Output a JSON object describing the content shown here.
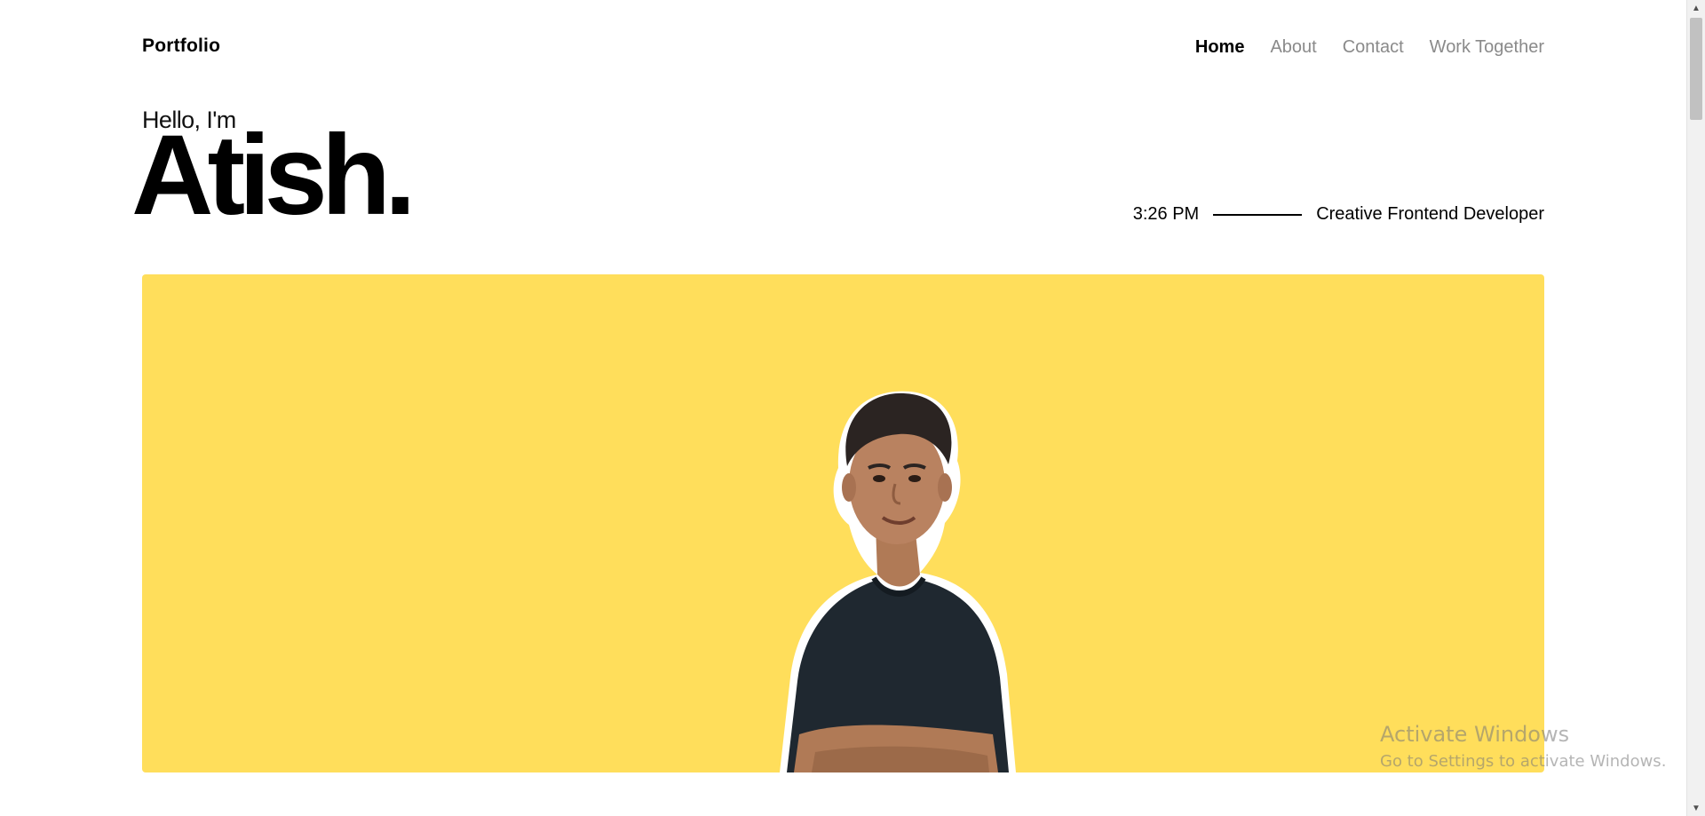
{
  "header": {
    "brand": "Portfolio",
    "nav": [
      {
        "label": "Home",
        "active": true
      },
      {
        "label": "About",
        "active": false
      },
      {
        "label": "Contact",
        "active": false
      },
      {
        "label": "Work Together",
        "active": false
      }
    ]
  },
  "hero": {
    "greeting": "Hello, I'm",
    "name": "Atish.",
    "time": "3:26 PM",
    "role": "Creative Frontend Developer"
  },
  "colors": {
    "hero_background": "#ffde5b",
    "nav_inactive": "#8a8a8a",
    "text": "#000000"
  },
  "watermark": {
    "title": "Activate Windows",
    "subtitle": "Go to Settings to activate Windows."
  }
}
